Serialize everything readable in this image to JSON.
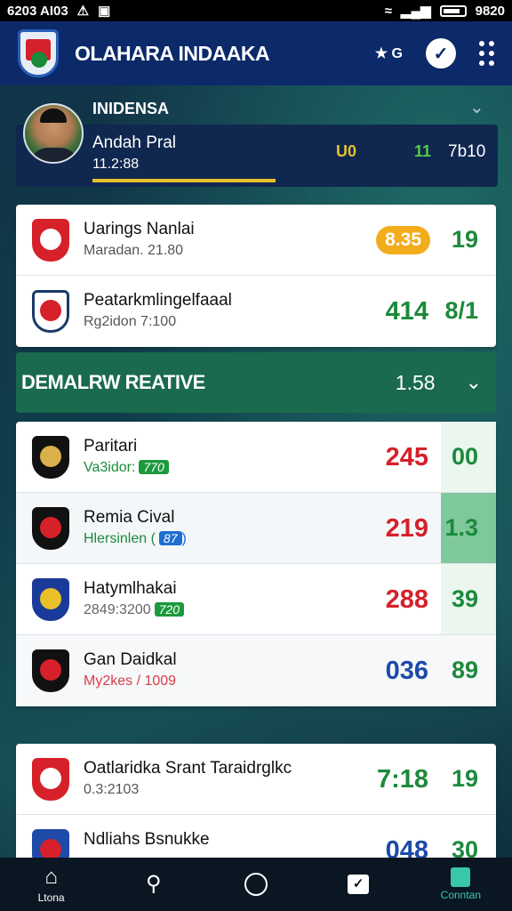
{
  "status_bar": {
    "time": "6203 AI03",
    "right_text": "9820"
  },
  "header": {
    "title": "OLAHARA INDAAKA",
    "small_action": "★ G"
  },
  "featured": {
    "label": "INIDENSA",
    "player_name": "Andah Pral",
    "player_sub": "11.2:88",
    "score1": "U0",
    "score2": "11",
    "score3": "7b10",
    "progress": 0.38
  },
  "group1": [
    {
      "name": "Uarings Nanlai",
      "sub": "Maradan. 21.80",
      "pill": "8.35",
      "score2": "19",
      "crest_colors": [
        "#d6202a",
        "#ffffff"
      ]
    },
    {
      "name": "Peatarkmlingelfaaal",
      "sub": "Rg2idon 7:100",
      "score": "414",
      "score_color": "#1c8a3c",
      "score2": "8/1",
      "crest_colors": [
        "#ffffff",
        "#d6202a"
      ]
    }
  ],
  "section": {
    "title": "DEMALRW REATIVE",
    "value": "1.58"
  },
  "group2": [
    {
      "name": "Paritari",
      "sub": "Va3idor:",
      "tag": "770",
      "tag_color": "#1c9a3c",
      "sub_color": "#1c8a3c",
      "score": "245",
      "score_color": "#d6202a",
      "score2": "00",
      "highlight": "#eaf6ee",
      "crest_colors": [
        "#111111",
        "#d9b04a"
      ]
    },
    {
      "name": "Remia Cival",
      "sub": "Hlersinlen (",
      "tag": "87",
      "tag_color": "#1e6fd0",
      "sub_color": "#1c8a3c",
      "tag_suffix": ")",
      "score": "219",
      "score_color": "#d6202a",
      "score2": "1.3",
      "highlight": "#7fc89c",
      "crest_colors": [
        "#111111",
        "#d6202a"
      ]
    },
    {
      "name": "Hatymlhakai",
      "sub": "2849:3200",
      "tag": "720",
      "tag_color": "#1c9a3c",
      "sub_color": "#666666",
      "score": "288",
      "score_color": "#d6202a",
      "score2": "39",
      "highlight": "#eaf6ee",
      "crest_colors": [
        "#1a3a9a",
        "#e8c02a"
      ]
    },
    {
      "name": "Gan Daidkal",
      "sub": "My2kes / 1009",
      "sub_color": "#d6404a",
      "score": "036",
      "score_color": "#1e4aa8",
      "score2": "89",
      "crest_colors": [
        "#111111",
        "#d6202a"
      ]
    }
  ],
  "group3": [
    {
      "name": "Oatlaridka Srant Taraidrglkc",
      "sub": "0.3:2103",
      "score": "7:18",
      "score_color": "#1c8a3c",
      "score2": "19",
      "crest_colors": [
        "#d6202a",
        "#ffffff"
      ]
    },
    {
      "name": "Ndliahs Bsnukke",
      "sub": "",
      "score": "048",
      "score_color": "#1e4aa8",
      "score2": "30",
      "crest_colors": [
        "#1e4aa8",
        "#d6202a"
      ]
    }
  ],
  "nav": [
    {
      "label": "Ltona",
      "icon": "home-icon"
    },
    {
      "label": "",
      "icon": "search-icon"
    },
    {
      "label": "",
      "icon": "circle-icon"
    },
    {
      "label": "",
      "icon": "check-box-icon"
    },
    {
      "label": "Conntan",
      "icon": "bag-icon"
    }
  ]
}
